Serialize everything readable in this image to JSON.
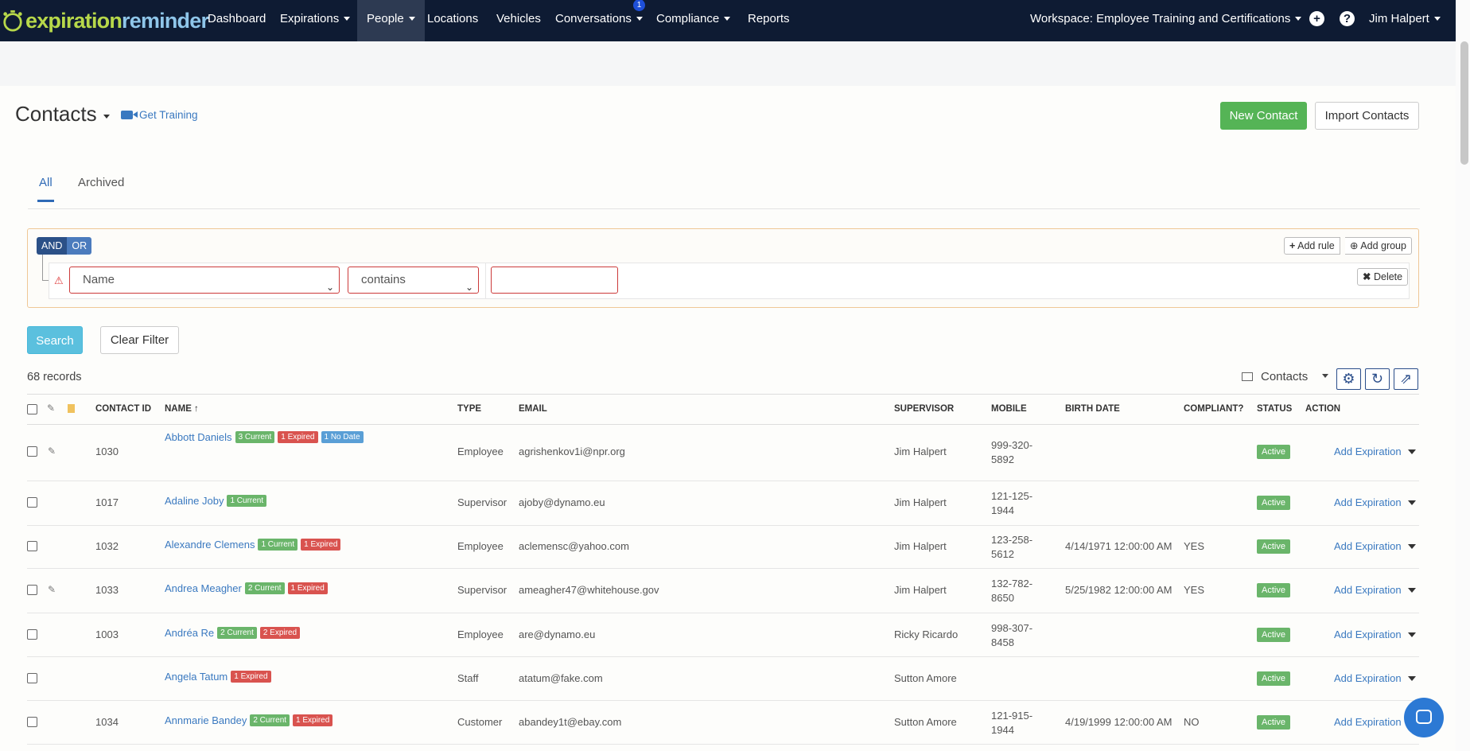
{
  "brand": {
    "name_part1": "expiration",
    "name_part2": "reminder",
    "colors": {
      "green": "#b7d84a",
      "blue": "#8fc6ea",
      "nav_bg": "#0e1b33"
    }
  },
  "nav": {
    "items": [
      "Dashboard",
      "Expirations",
      "People",
      "Locations",
      "Vehicles",
      "Conversations",
      "Compliance",
      "Reports"
    ],
    "conversations_badge": "1",
    "workspace": "Workspace: Employee Training and Certifications",
    "user": "Jim Halpert"
  },
  "header": {
    "title": "Contacts",
    "training_link": "Get Training",
    "new_button": "New Contact",
    "import_button": "Import Contacts"
  },
  "tabs": [
    "All",
    "Archived"
  ],
  "filter": {
    "and_label": "AND",
    "or_label": "OR",
    "add_rule": "Add rule",
    "add_group": "Add group",
    "delete": "Delete",
    "field_value": "Name",
    "operator_value": "contains",
    "text_value": ""
  },
  "actions": {
    "search": "Search",
    "clear": "Clear Filter"
  },
  "records": "68 records",
  "view_select": "Contacts",
  "table": {
    "columns": [
      "CONTACT ID",
      "NAME ↑",
      "TYPE",
      "EMAIL",
      "SUPERVISOR",
      "MOBILE",
      "BIRTH DATE",
      "COMPLIANT?",
      "STATUS",
      "ACTION"
    ],
    "rows": [
      {
        "id": "1030",
        "name": "Abbott Daniels",
        "current": "3 Current",
        "expired": "1 Expired",
        "nodate": "1 No Date",
        "type": "Employee",
        "email": "agrishenkov1i@npr.org",
        "supervisor": "Jim Halpert",
        "mobile1": "999-320-",
        "mobile2": "5892",
        "birth": "",
        "compliant": "",
        "status": "Active",
        "action": "Add Expiration",
        "attach": true
      },
      {
        "id": "1017",
        "name": "Adaline Joby",
        "current": "1 Current",
        "expired": "",
        "nodate": "",
        "type": "Supervisor",
        "email": "ajoby@dynamo.eu",
        "supervisor": "Jim Halpert",
        "mobile1": "121-125-",
        "mobile2": "1944",
        "birth": "",
        "compliant": "",
        "status": "Active",
        "action": "Add Expiration",
        "attach": false
      },
      {
        "id": "1032",
        "name": "Alexandre Clemens",
        "current": "1 Current",
        "expired": "1 Expired",
        "nodate": "",
        "type": "Employee",
        "email": "aclemensc@yahoo.com",
        "supervisor": "Jim Halpert",
        "mobile1": "123-258-",
        "mobile2": "5612",
        "birth": "4/14/1971 12:00:00 AM",
        "compliant": "YES",
        "status": "Active",
        "action": "Add Expiration",
        "attach": false
      },
      {
        "id": "1033",
        "name": "Andrea Meagher",
        "current": "2 Current",
        "expired": "1 Expired",
        "nodate": "",
        "type": "Supervisor",
        "email": "ameagher47@whitehouse.gov",
        "supervisor": "Jim Halpert",
        "mobile1": "132-782-",
        "mobile2": "8650",
        "birth": "5/25/1982 12:00:00 AM",
        "compliant": "YES",
        "status": "Active",
        "action": "Add Expiration",
        "attach": true
      },
      {
        "id": "1003",
        "name": "Andréa Re",
        "current": "2 Current",
        "expired": "2 Expired",
        "nodate": "",
        "type": "Employee",
        "email": "are@dynamo.eu",
        "supervisor": "Ricky Ricardo",
        "mobile1": "998-307-",
        "mobile2": "8458",
        "birth": "",
        "compliant": "",
        "status": "Active",
        "action": "Add Expiration",
        "attach": false
      },
      {
        "id": "",
        "name": "Angela Tatum",
        "current": "",
        "expired": "1 Expired",
        "nodate": "",
        "type": "Staff",
        "email": "atatum@fake.com",
        "supervisor": "Sutton Amore",
        "mobile1": "",
        "mobile2": "",
        "birth": "",
        "compliant": "",
        "status": "Active",
        "action": "Add Expiration",
        "attach": false
      },
      {
        "id": "1034",
        "name": "Annmarie Bandey",
        "current": "2 Current",
        "expired": "1 Expired",
        "nodate": "",
        "type": "Customer",
        "email": "abandey1t@ebay.com",
        "supervisor": "Sutton Amore",
        "mobile1": "121-915-",
        "mobile2": "1944",
        "birth": "4/19/1999 12:00:00 AM",
        "compliant": "NO",
        "status": "Active",
        "action": "Add Expiration",
        "attach": false
      }
    ]
  }
}
